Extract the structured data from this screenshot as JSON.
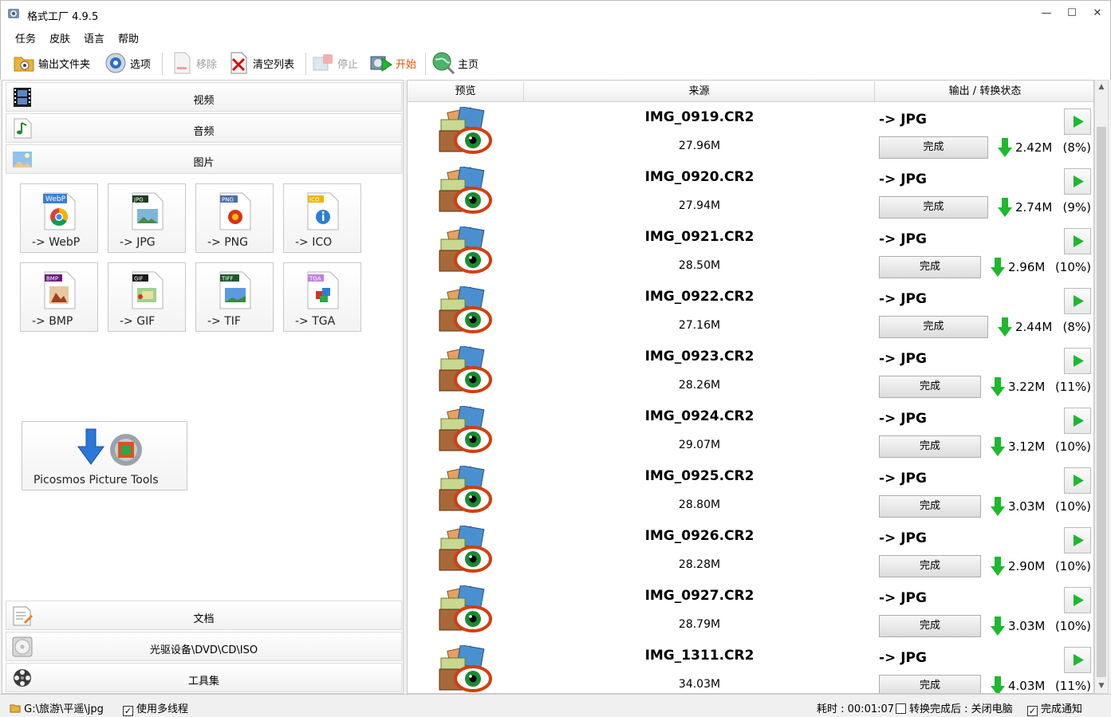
{
  "window": {
    "title": "格式工厂 4.9.5",
    "minimize": "—",
    "maximize": "☐",
    "close": "✕"
  },
  "menu": [
    "任务",
    "皮肤",
    "语言",
    "帮助"
  ],
  "toolbar": {
    "output_folder": "输出文件夹",
    "options": "选项",
    "remove": "移除",
    "clear_list": "清空列表",
    "stop": "停止",
    "start": "开始",
    "home": "主页"
  },
  "categories": {
    "video": "视频",
    "audio": "音频",
    "picture": "图片",
    "document": "文档",
    "disc": "光驱设备\\DVD\\CD\\ISO",
    "tools": "工具集"
  },
  "picture_formats": [
    {
      "label": "-> WebP",
      "badge": "WebP",
      "color": "#3a7fd5"
    },
    {
      "label": "-> JPG",
      "badge": "JPG",
      "color": "#1a3d1a"
    },
    {
      "label": "-> PNG",
      "badge": "PNG",
      "color": "#4a6ea8"
    },
    {
      "label": "-> ICO",
      "badge": "ICO",
      "color": "#f0b400"
    },
    {
      "label": "-> BMP",
      "badge": "BMP",
      "color": "#6a1a7a"
    },
    {
      "label": "-> GIF",
      "badge": "GIF",
      "color": "#1a1a1a"
    },
    {
      "label": "-> TIF",
      "badge": "TIFF",
      "color": "#1a5a2a"
    },
    {
      "label": "-> TGA",
      "badge": "TGA",
      "color": "#c080e0"
    }
  ],
  "picosmos": "Picosmos Picture Tools",
  "columns": {
    "preview": "预览",
    "source": "来源",
    "output": "输出 / 转换状态"
  },
  "rows": [
    {
      "name": "IMG_0919.CR2",
      "size": "27.96M",
      "fmt": "-> JPG",
      "status": "完成",
      "out": "2.42M",
      "pct": "(8%)"
    },
    {
      "name": "IMG_0920.CR2",
      "size": "27.94M",
      "fmt": "-> JPG",
      "status": "完成",
      "out": "2.74M",
      "pct": "(9%)"
    },
    {
      "name": "IMG_0921.CR2",
      "size": "28.50M",
      "fmt": "-> JPG",
      "status": "完成",
      "out": "2.96M",
      "pct": "(10%)"
    },
    {
      "name": "IMG_0922.CR2",
      "size": "27.16M",
      "fmt": "-> JPG",
      "status": "完成",
      "out": "2.44M",
      "pct": "(8%)"
    },
    {
      "name": "IMG_0923.CR2",
      "size": "28.26M",
      "fmt": "-> JPG",
      "status": "完成",
      "out": "3.22M",
      "pct": "(11%)"
    },
    {
      "name": "IMG_0924.CR2",
      "size": "29.07M",
      "fmt": "-> JPG",
      "status": "完成",
      "out": "3.12M",
      "pct": "(10%)"
    },
    {
      "name": "IMG_0925.CR2",
      "size": "28.80M",
      "fmt": "-> JPG",
      "status": "完成",
      "out": "3.03M",
      "pct": "(10%)"
    },
    {
      "name": "IMG_0926.CR2",
      "size": "28.28M",
      "fmt": "-> JPG",
      "status": "完成",
      "out": "2.90M",
      "pct": "(10%)"
    },
    {
      "name": "IMG_0927.CR2",
      "size": "28.79M",
      "fmt": "-> JPG",
      "status": "完成",
      "out": "3.03M",
      "pct": "(10%)"
    },
    {
      "name": "IMG_1311.CR2",
      "size": "34.03M",
      "fmt": "-> JPG",
      "status": "完成",
      "out": "4.03M",
      "pct": "(11%)"
    }
  ],
  "statusbar": {
    "path": "G:\\旅游\\平遥\\jpg",
    "multithread": "使用多线程",
    "elapsed": "耗时 : 00:01:07",
    "after_convert": "转换完成后 : 关闭电脑",
    "notify": "完成通知"
  },
  "colors": {
    "accent_green": "#1db92e",
    "start_orange": "#e05000",
    "disabled": "#a0a0a0"
  }
}
